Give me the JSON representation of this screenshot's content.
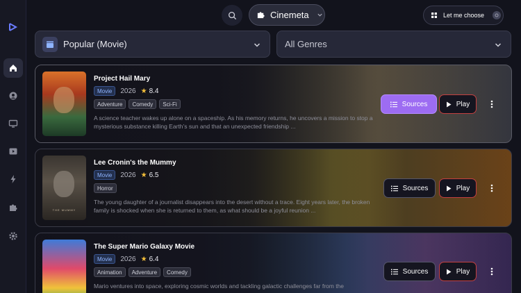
{
  "topbar": {
    "addon_label": "Cinemeta",
    "choose_label": "Let me choose"
  },
  "filters": {
    "category": "Popular (Movie)",
    "genre": "All Genres"
  },
  "sidebar": {
    "items": [
      {
        "icon": "home-icon",
        "active": true
      },
      {
        "icon": "discover-icon",
        "active": false
      },
      {
        "icon": "tv-icon",
        "active": false
      },
      {
        "icon": "video-icon",
        "active": false
      },
      {
        "icon": "bolt-icon",
        "active": false
      },
      {
        "icon": "puzzle-icon",
        "active": false
      },
      {
        "icon": "gear-icon",
        "active": false
      }
    ]
  },
  "movies": [
    {
      "title": "Project Hail Mary",
      "type": "Movie",
      "year": "2026",
      "rating": "8.4",
      "genres": [
        "Adventure",
        "Comedy",
        "Sci-Fi"
      ],
      "description": "A science teacher wakes up alone on a spaceship. As his memory returns, he uncovers a mission to stop a mysterious substance killing Earth’s sun and that an unexpected friendship ...",
      "sources_label": "Sources",
      "play_label": "Play"
    },
    {
      "title": "Lee Cronin's the Mummy",
      "type": "Movie",
      "year": "2026",
      "rating": "6.5",
      "genres": [
        "Horror"
      ],
      "description": "The young daughter of a journalist disappears into the desert without a trace. Eight years later, the broken family is shocked when she is returned to them, as what should be a joyful reunion ...",
      "poster_text": "THE MUMMY",
      "sources_label": "Sources",
      "play_label": "Play"
    },
    {
      "title": "The Super Mario Galaxy Movie",
      "type": "Movie",
      "year": "2026",
      "rating": "6.4",
      "genres": [
        "Animation",
        "Adventure",
        "Comedy"
      ],
      "description": "Mario ventures into space, exploring cosmic worlds and tackling galactic challenges far from the",
      "sources_label": "Sources",
      "play_label": "Play"
    }
  ],
  "colors": {
    "accent": "#9d6cf2",
    "play_border": "#c44040",
    "star": "#f5c03a",
    "background": "#12131c"
  }
}
